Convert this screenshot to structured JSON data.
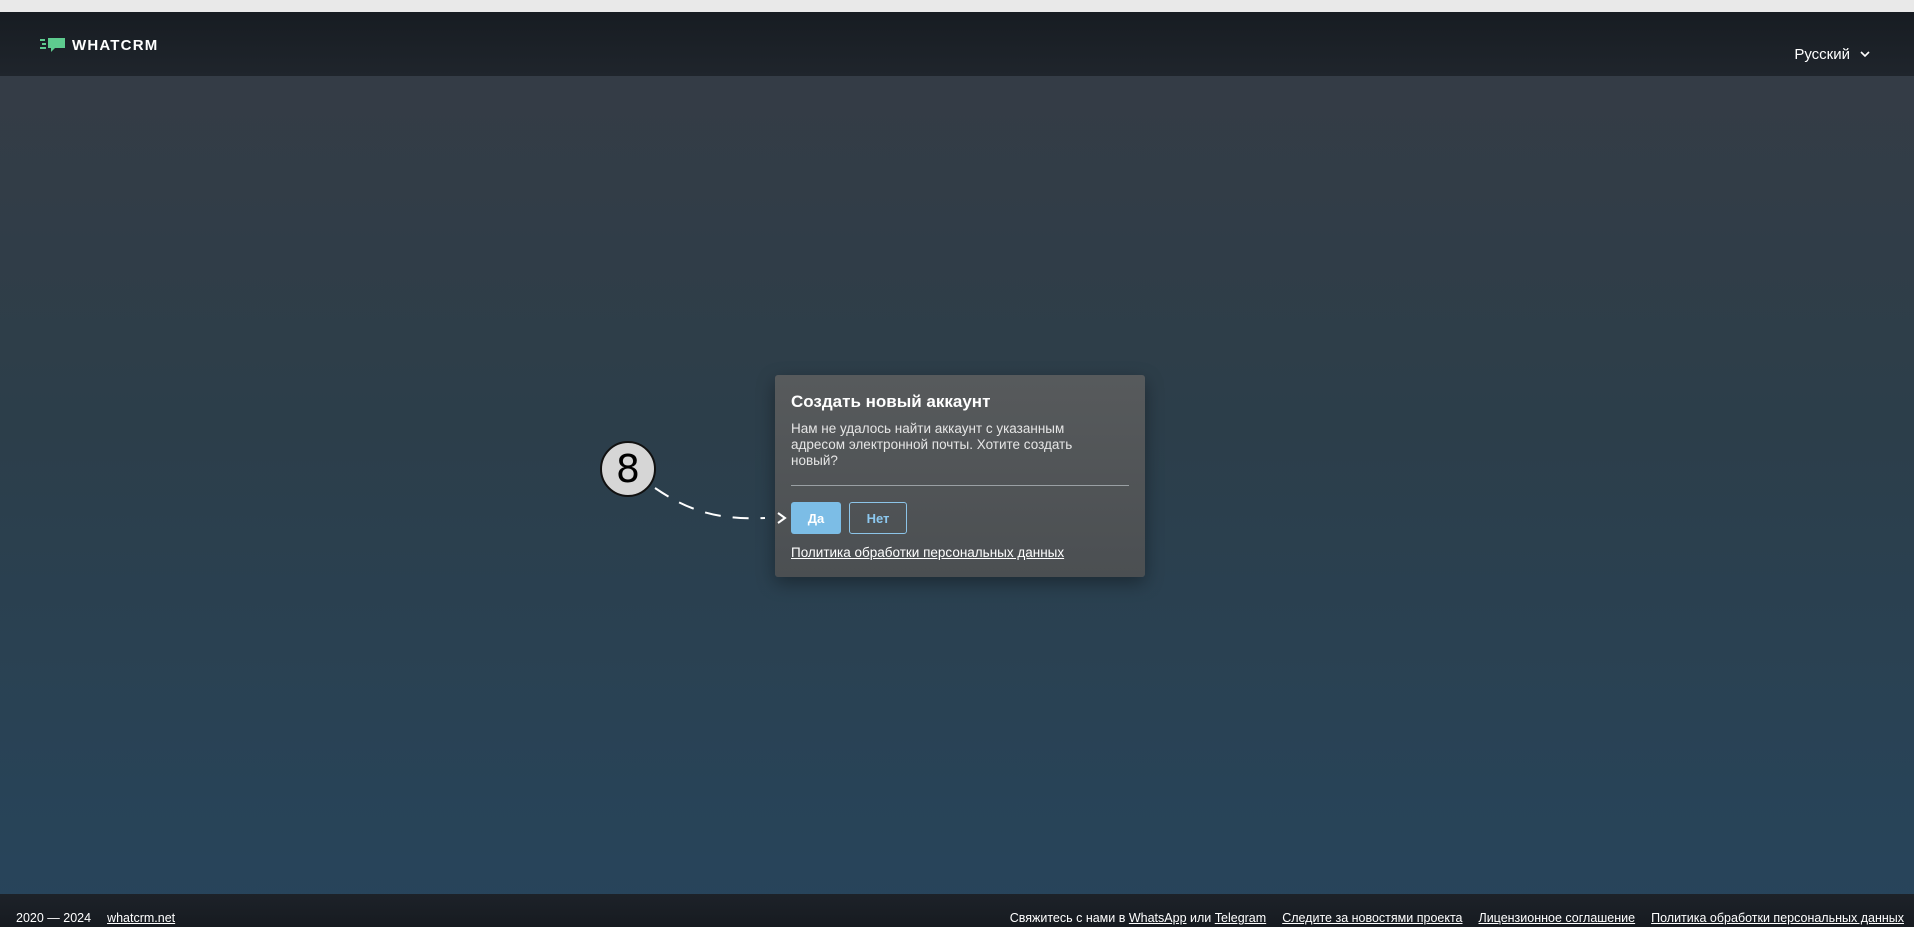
{
  "header": {
    "logo_text": "WHATCRM",
    "language": "Русский",
    "logo_color": "#5ecb8f"
  },
  "dialog": {
    "title": "Создать новый аккаунт",
    "message": "Нам не удалось найти аккаунт с указанным адресом электронной почты. Хотите создать новый?",
    "yes_label": "Да",
    "no_label": "Нет",
    "policy_link": "Политика обработки персональных данных"
  },
  "annotation": {
    "step_number": "8"
  },
  "footer": {
    "years": "2020 — 2024",
    "site_link": "whatcrm.net",
    "contact_prefix": "Свяжитесь с нами в",
    "whatsapp_link": "WhatsApp",
    "or_text": "или",
    "telegram_link": "Telegram",
    "news_link": "Следите за новостями проекта",
    "license_link": "Лицензионное соглашение",
    "privacy_link": "Политика обработки персональных данных"
  },
  "colors": {
    "accent": "#7cbde6",
    "header_bg": "#1b2026",
    "dialog_bg": "#53575a"
  }
}
